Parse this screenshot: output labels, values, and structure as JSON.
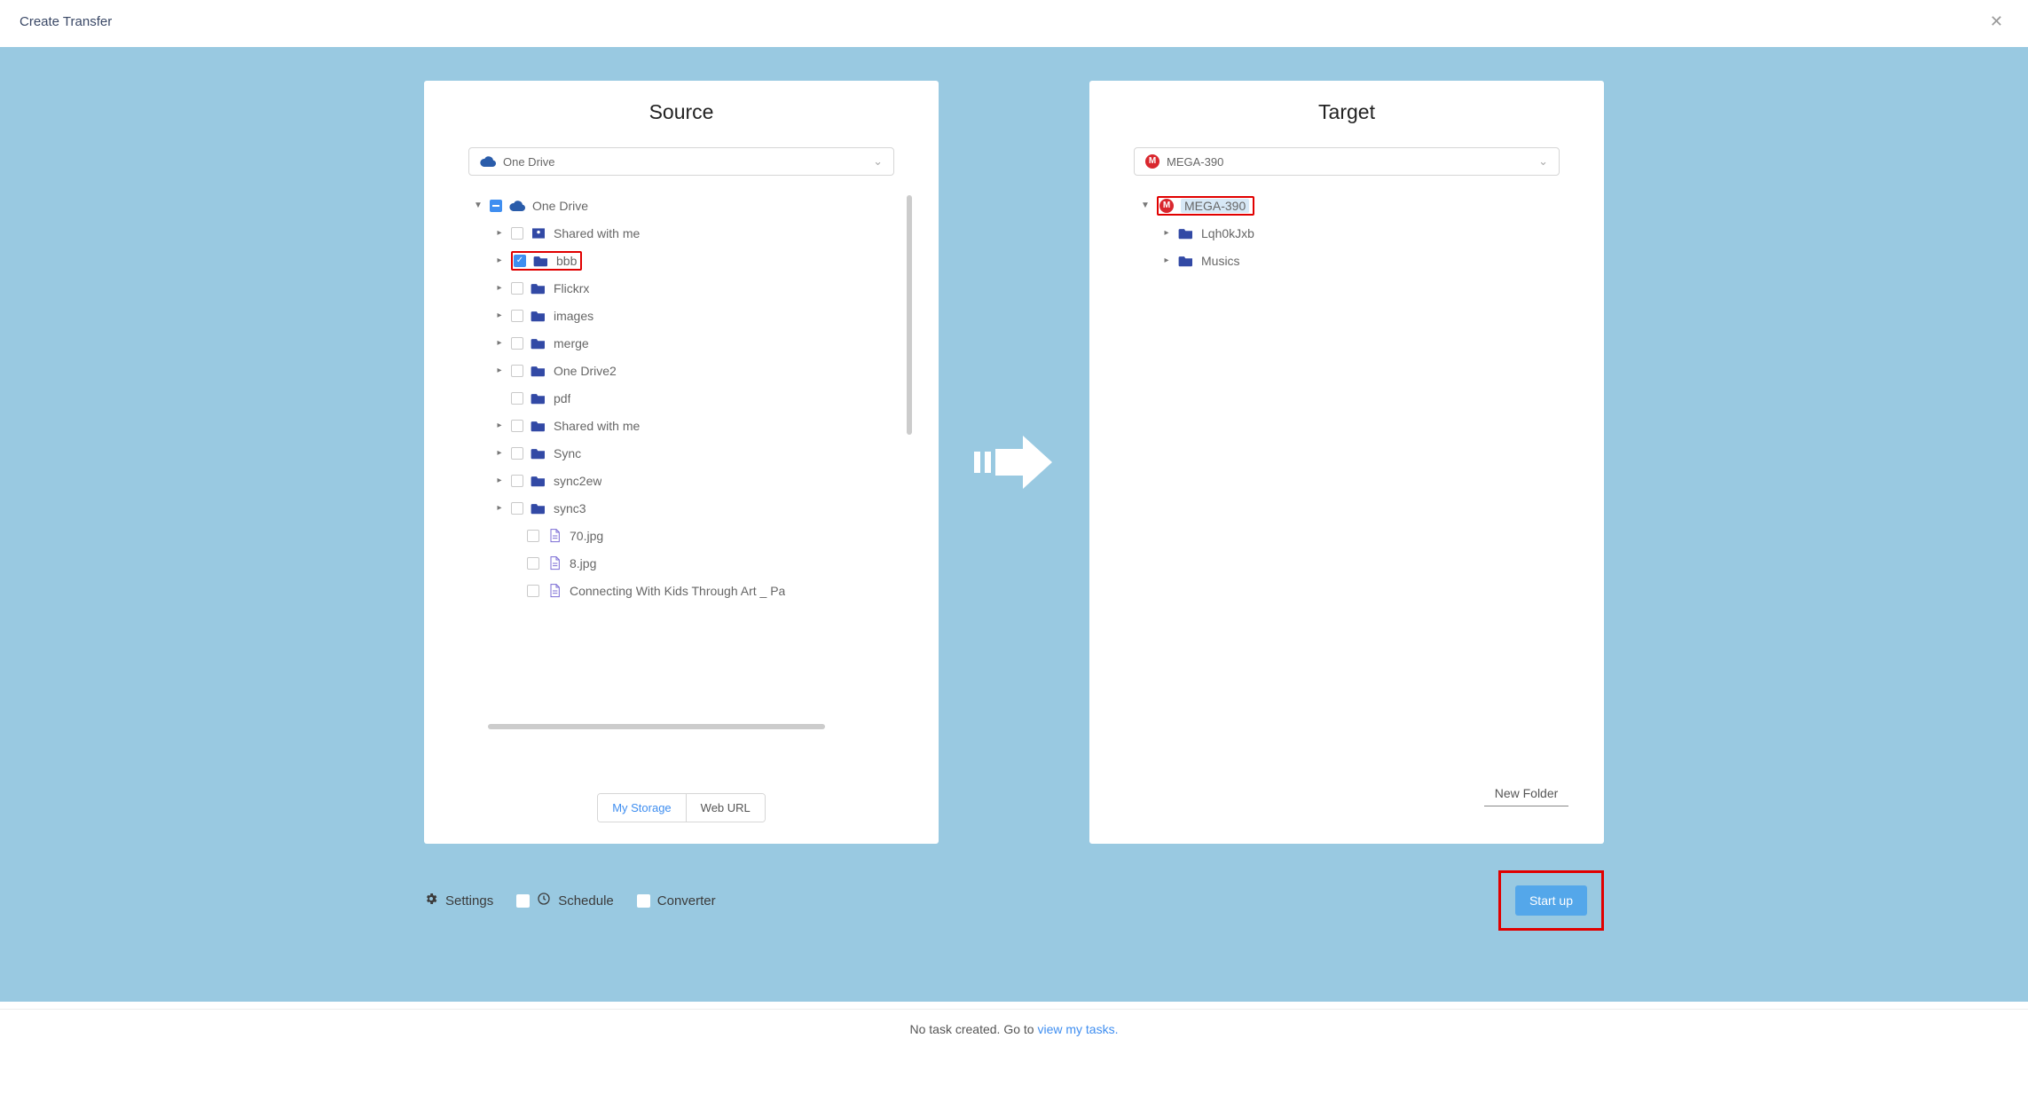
{
  "header": {
    "title": "Create Transfer"
  },
  "source": {
    "heading": "Source",
    "selector_label": "One Drive",
    "root_label": "One Drive",
    "children": [
      {
        "type": "sharefolder",
        "label": "Shared with me",
        "checked": false,
        "expandable": true
      },
      {
        "type": "folder",
        "label": "bbb",
        "checked": true,
        "expandable": true,
        "highlight": true
      },
      {
        "type": "folder",
        "label": "Flickrx",
        "checked": false,
        "expandable": true
      },
      {
        "type": "folder",
        "label": "images",
        "checked": false,
        "expandable": true
      },
      {
        "type": "folder",
        "label": "merge",
        "checked": false,
        "expandable": true
      },
      {
        "type": "folder",
        "label": "One Drive2",
        "checked": false,
        "expandable": true
      },
      {
        "type": "folder",
        "label": "pdf",
        "checked": false,
        "expandable": false
      },
      {
        "type": "folder",
        "label": "Shared with me",
        "checked": false,
        "expandable": true
      },
      {
        "type": "folder",
        "label": "Sync",
        "checked": false,
        "expandable": true
      },
      {
        "type": "folder",
        "label": "sync2ew",
        "checked": false,
        "expandable": true
      },
      {
        "type": "folder",
        "label": "sync3",
        "checked": false,
        "expandable": true
      },
      {
        "type": "file",
        "label": "70.jpg",
        "checked": false,
        "expandable": false
      },
      {
        "type": "file",
        "label": "8.jpg",
        "checked": false,
        "expandable": false
      },
      {
        "type": "file",
        "label": "Connecting With Kids Through Art _ Pa",
        "checked": false,
        "expandable": false
      }
    ],
    "tabs": {
      "storage": "My Storage",
      "weburl": "Web URL"
    }
  },
  "target": {
    "heading": "Target",
    "selector_label": "MEGA-390",
    "root_label": "MEGA-390",
    "children": [
      {
        "type": "folder",
        "label": "Lqh0kJxb",
        "expandable": true
      },
      {
        "type": "folder",
        "label": "Musics",
        "expandable": true
      }
    ],
    "new_folder_label": "New Folder"
  },
  "options": {
    "settings": "Settings",
    "schedule": "Schedule",
    "converter": "Converter",
    "start": "Start up"
  },
  "status": {
    "prefix": "No task created. Go to ",
    "link": "view my tasks."
  }
}
